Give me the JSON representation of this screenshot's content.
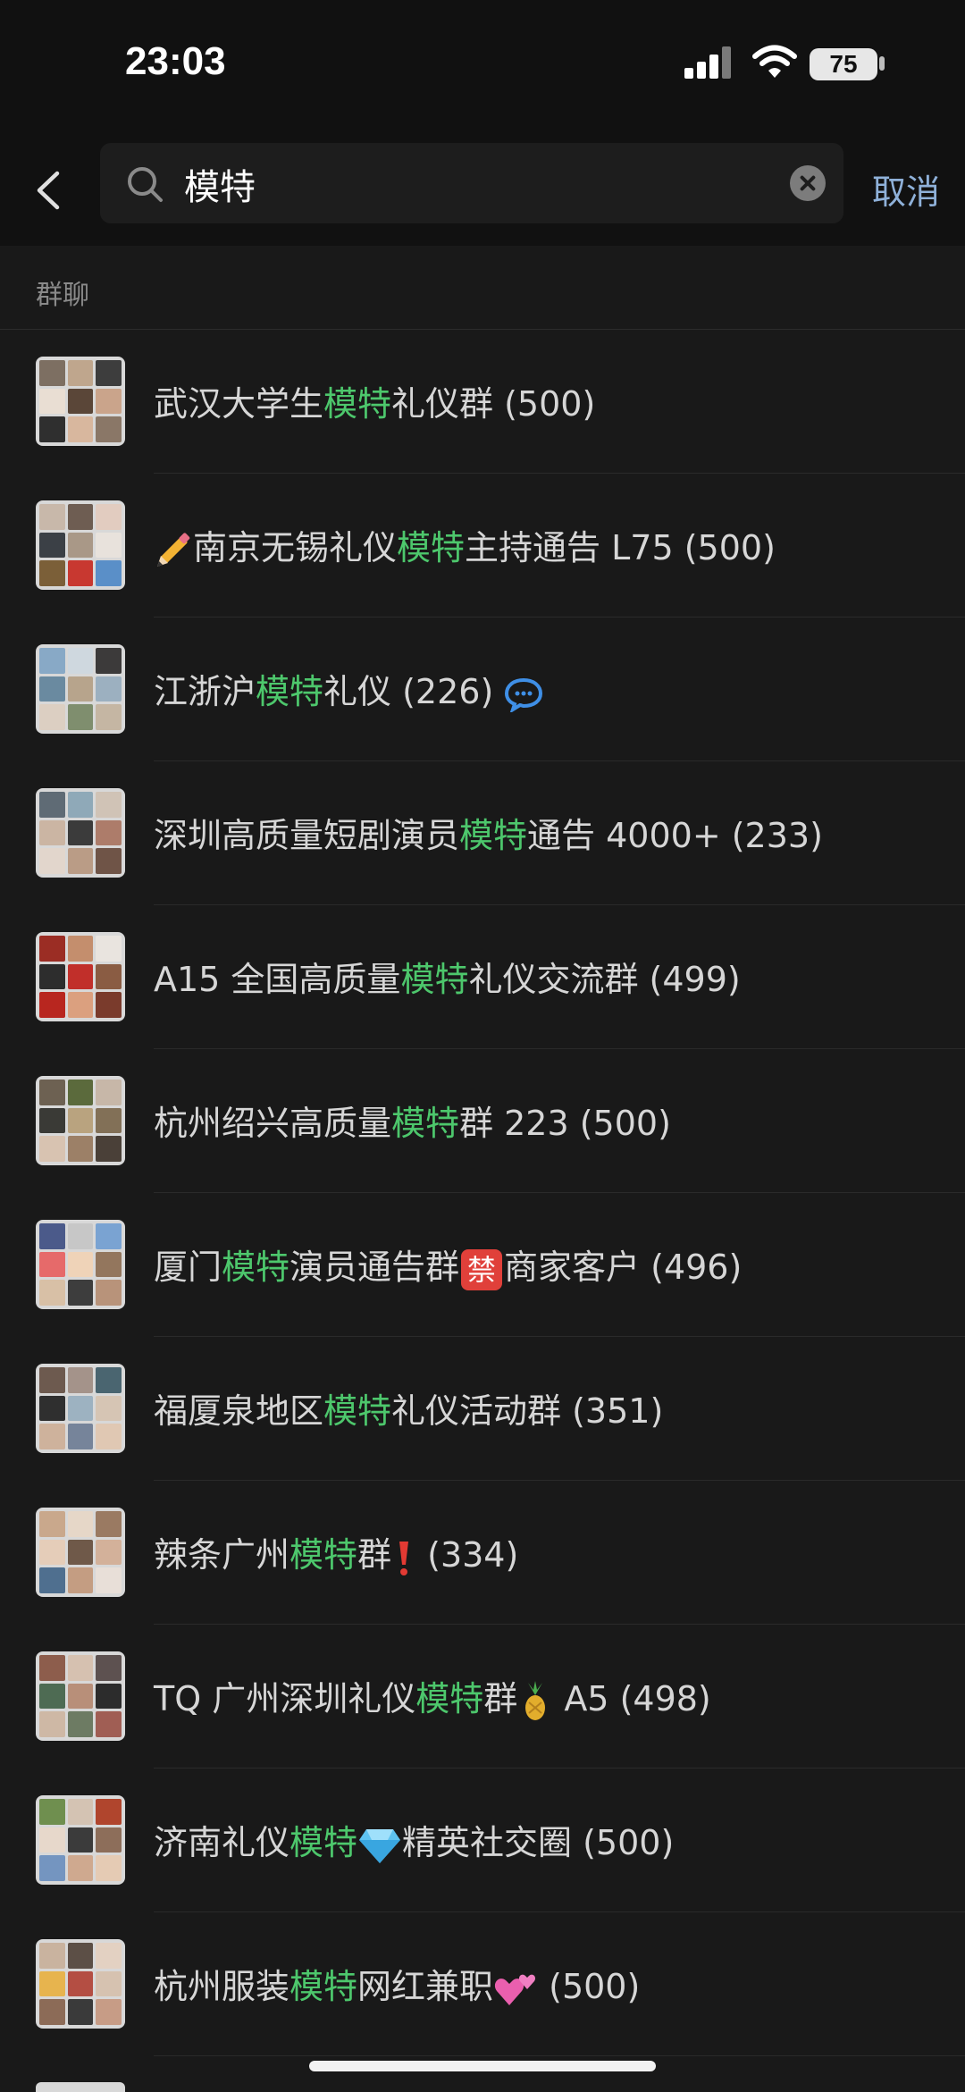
{
  "status_bar": {
    "time": "23:03",
    "battery_level": "75"
  },
  "search": {
    "query": "模特",
    "cancel_label": "取消"
  },
  "section": {
    "title": "群聊"
  },
  "results": [
    {
      "before": "武汉大学生",
      "highlight": "模特",
      "after": "礼仪群 (500)"
    },
    {
      "emoji": "pencil-icon",
      "before": "南京无锡礼仪",
      "highlight": "模特",
      "after": "主持通告 L75 (500)"
    },
    {
      "before": "江浙沪",
      "highlight": "模特",
      "after": "礼仪 (226)",
      "trailing_icon": "chat-bubble-icon"
    },
    {
      "before": "深圳高质量短剧演员",
      "highlight": "模特",
      "after": "通告 4000+ (233)"
    },
    {
      "before": "A15 全国高质量",
      "highlight": "模特",
      "after": "礼仪交流群 (499)"
    },
    {
      "before": "杭州绍兴高质量",
      "highlight": "模特",
      "after": "群 223 (500)"
    },
    {
      "before": "厦门",
      "highlight": "模特",
      "after_parts": [
        "演员通告群",
        "商家客户 (496)"
      ],
      "inline_icon": "prohibited-badge-icon",
      "badge_text": "禁"
    },
    {
      "before": "福厦泉地区",
      "highlight": "模特",
      "after": "礼仪活动群 (351)"
    },
    {
      "before": "辣条广州",
      "highlight": "模特",
      "after_parts": [
        "群",
        "  (334)"
      ],
      "inline_icon": "exclamation-icon"
    },
    {
      "before": "TQ 广州深圳礼仪",
      "highlight": "模特",
      "after_parts": [
        "群",
        "  A5 (498)"
      ],
      "inline_icon": "pineapple-icon"
    },
    {
      "before": "济南礼仪",
      "highlight": "模特",
      "after_parts": [
        "",
        "精英社交圈 (500)"
      ],
      "inline_icon": "gem-icon"
    },
    {
      "before": "杭州服装",
      "highlight": "模特",
      "after_parts": [
        "网红兼职",
        "  (500)"
      ],
      "inline_icon": "hearts-icon"
    }
  ],
  "colors": {
    "highlight": "#4dc76c",
    "background": "#191919",
    "cancel": "#8fb1d9"
  }
}
